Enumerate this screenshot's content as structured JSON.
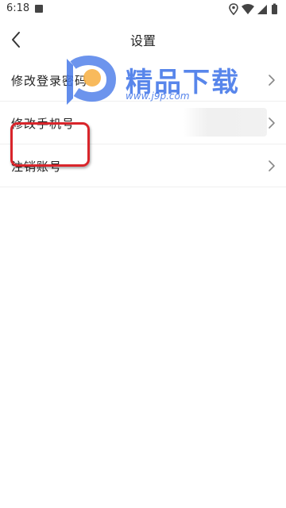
{
  "status_bar": {
    "time": "6:18",
    "icons": [
      "notification-square-icon",
      "location-icon",
      "wifi-icon",
      "signal-icon",
      "battery-icon"
    ]
  },
  "header": {
    "title": "设置",
    "back_icon": "chevron-left-icon"
  },
  "settings": {
    "items": [
      {
        "label": "修改登录密码",
        "icon": "chevron-right-icon"
      },
      {
        "label": "修改手机号",
        "icon": "chevron-right-icon"
      },
      {
        "label": "注销账号",
        "icon": "chevron-right-icon"
      }
    ]
  },
  "watermark": {
    "title": "精品下载",
    "url": "www.j9p.com"
  },
  "colors": {
    "highlight": "#d9252b",
    "watermark_blue": "#4779e9",
    "watermark_orange": "#f7b24a"
  }
}
